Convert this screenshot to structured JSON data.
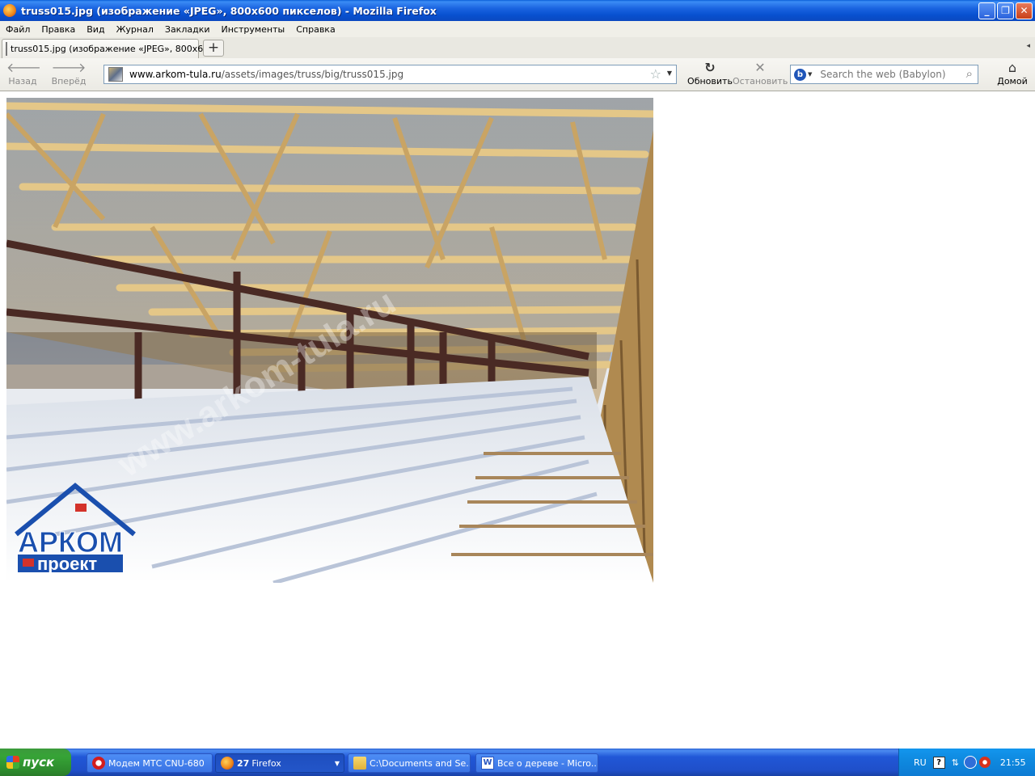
{
  "window": {
    "title": "truss015.jpg (изображение «JPEG», 800x600 пикселов) - Mozilla Firefox",
    "controls": {
      "minimize": "_",
      "restore": "❐",
      "close": "✕"
    }
  },
  "menu": [
    {
      "label": "Файл"
    },
    {
      "label": "Правка"
    },
    {
      "label": "Вид"
    },
    {
      "label": "Журнал"
    },
    {
      "label": "Закладки"
    },
    {
      "label": "Инструменты"
    },
    {
      "label": "Справка"
    }
  ],
  "tab": {
    "label": "truss015.jpg (изображение «JPEG», 800x6...",
    "new_tab": "+"
  },
  "nav": {
    "back": "Назад",
    "forward": "Вперёд",
    "reload": "Обновить",
    "stop": "Остановить",
    "home": "Домой"
  },
  "url": {
    "host": "www.arkom-tula.ru",
    "path": "/assets/images/truss/big/truss015.jpg"
  },
  "search": {
    "placeholder": "Search the web (Babylon)"
  },
  "image": {
    "watermark": "www.arkom-tula.ru",
    "logo_top": "АРКОМ",
    "logo_bottom": "проект",
    "colors": {
      "sky": "#5a8ad8",
      "wood": "#d9b97a",
      "steel": "#4a2a24",
      "snow": "#f2f4f8",
      "logo_blue": "#1a4fae",
      "logo_red": "#d3322a"
    }
  },
  "taskbar": {
    "start": "пуск",
    "tasks": [
      {
        "label": "Модем МТС CNU-680"
      },
      {
        "count": "27",
        "label": "Firefox"
      },
      {
        "label": "C:\\Documents and Se..."
      },
      {
        "label": "Все о дереве - Micro..."
      }
    ],
    "tray": {
      "lang": "RU",
      "help": "?",
      "clock": "21:55"
    }
  }
}
